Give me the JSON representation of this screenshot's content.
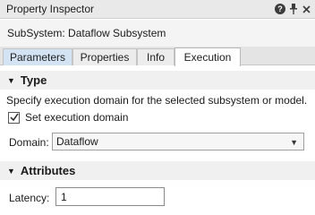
{
  "window": {
    "title": "Property Inspector",
    "controls": [
      "help-icon",
      "pin-icon",
      "close-icon"
    ]
  },
  "subsystem": {
    "text": "SubSystem: Dataflow Subsystem"
  },
  "tabs": [
    {
      "label": "Parameters",
      "selected": false
    },
    {
      "label": "Properties",
      "selected": false
    },
    {
      "label": "Info",
      "selected": false
    },
    {
      "label": "Execution",
      "selected": true
    }
  ],
  "sections": {
    "type": {
      "title": "Type",
      "description": "Specify execution domain for the selected subsystem or model.",
      "checkbox_label": "Set execution domain",
      "checkbox_checked": true,
      "domain_label": "Domain:",
      "domain_value": "Dataflow"
    },
    "attributes": {
      "title": "Attributes",
      "latency_label": "Latency:",
      "latency_value": "1"
    }
  },
  "colors": {
    "titlebar_bg": "#e9e9e9",
    "selected_tab_bg": "#ffffff",
    "params_tab_bg": "#d3e3f4",
    "section_header_bg": "#f0f0f0"
  }
}
